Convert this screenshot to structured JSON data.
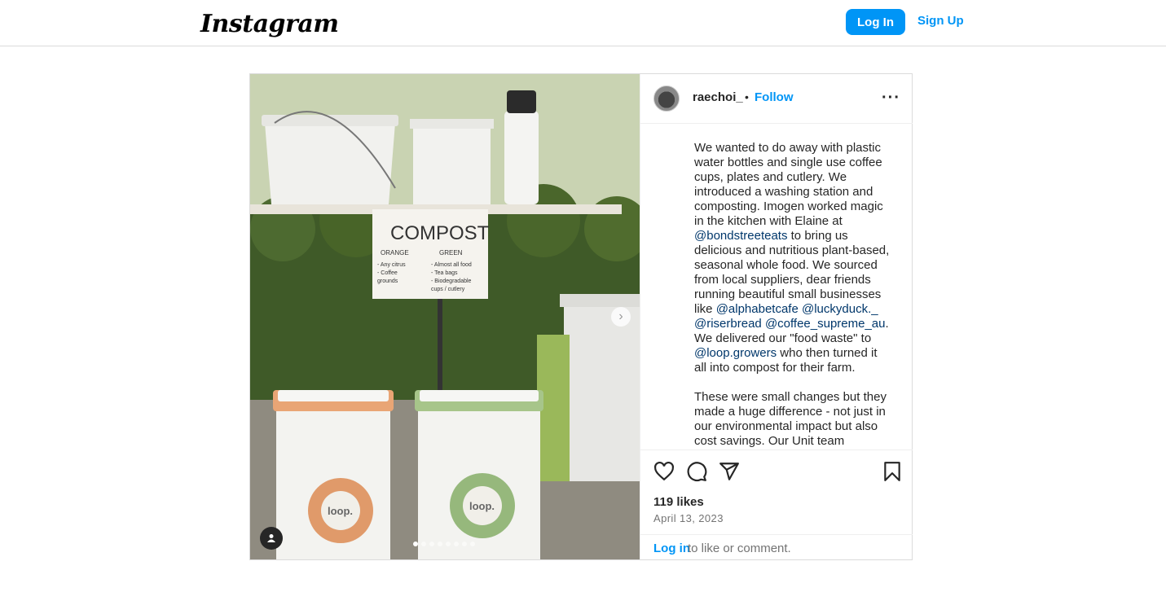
{
  "header": {
    "logo_text": "Instagram",
    "login_label": "Log In",
    "signup_label": "Sign Up"
  },
  "post": {
    "username": "raechoi_",
    "separator": "•",
    "follow_label": "Follow",
    "more_icon": "more-horizontal-icon",
    "photo": {
      "sign_title": "COMPOST",
      "sign_col1_head": "ORANGE",
      "sign_col1_items": [
        "- Any citrus",
        "- Coffee",
        "  grounds"
      ],
      "sign_col2_head": "GREEN",
      "sign_col2_items": [
        "- Almost all food",
        "- Tea bags",
        "- Biodegradable",
        "  cups / cutlery"
      ],
      "bin_label": "loop.",
      "carousel_count": 8,
      "carousel_active": 0
    },
    "caption": {
      "p1_a": "We wanted to do away with plastic water bottles and single use coffee cups, plates and cutlery. We introduced a washing station and composting. Imogen worked magic in the kitchen with Elaine at ",
      "mention_bondstreeteats": "@bondstreeteats",
      "p1_b": " to bring us delicious and nutritious plant-based, seasonal whole food. We sourced from local suppliers, dear friends running beautiful small businesses like ",
      "mention_alphabetcafe": "@alphabetcafe",
      "mention_luckyduck": "@luckyduck._",
      "mention_riserbread": "@riserbread",
      "mention_coffee_supreme": "@coffee_supreme_au",
      "p1_c": ". We delivered our \"food waste\" to ",
      "mention_loop": "@loop.growers",
      "p1_d": " who then turned it all into compost for their farm.",
      "p2": "These were small changes but they made a huge difference - not just in our environmental impact but also cost savings. Our Unit team"
    },
    "likes_text": "119 likes",
    "date_text": "April 13, 2023",
    "comment_login": "Log in",
    "comment_rest": "to like or comment."
  },
  "colors": {
    "accent": "#0095f6",
    "mention": "#00376b",
    "border": "#dbdbdb"
  }
}
